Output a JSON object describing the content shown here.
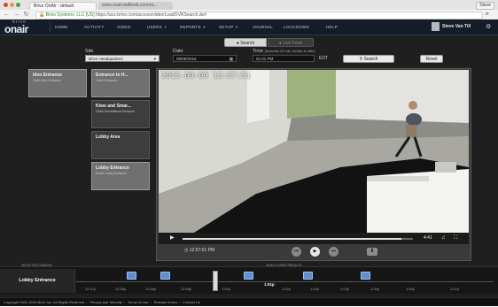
{
  "browser": {
    "tabs": [
      {
        "label": "Brivo OnAir - default"
      },
      {
        "label": "www.onairstaffweb.com/ac..."
      }
    ],
    "user_chip": "Steve",
    "url_secure": "Brivo Systems, LLC [US]",
    "url_path": "https://acs.brivo.com/access/video/LoadOVRSearch.do#"
  },
  "app": {
    "logo_top": "brivo",
    "logo_main": "onair",
    "nav": [
      "HOME",
      "ACTIVITY",
      "VIDEO",
      "USERS",
      "REPORTS",
      "SETUP",
      "JOURNAL",
      "LOCKDOWN",
      "HELP"
    ],
    "username": "Steve Van Till"
  },
  "mode": {
    "search_label": "Search",
    "live_label": "Live Feed"
  },
  "filters": {
    "site_label": "Site",
    "site_value": "Brivo Headquarters",
    "date_label": "Date",
    "date_value": "09/09/2015",
    "time_label": "Time",
    "time_hint": "(Includes 10 min. before & after)",
    "time_value": "01:01 PM",
    "tz": "EDT",
    "search_button": "Search",
    "reset_button": "Reset"
  },
  "cameras": [
    {
      "title": "Idvo Entrance",
      "sub": "OnAir Idvo Entrance"
    },
    {
      "title": "Entrance to H...",
      "sub": "OnAir Entrance..."
    },
    {
      "title": "Kiwo and Smar...",
      "sub": "OnAir Surveillance Entrance"
    },
    {
      "title": "Lobby Area",
      "sub": ""
    },
    {
      "title": "Lobby Entrance",
      "sub": "South Lobby Entrance"
    }
  ],
  "video": {
    "timestamp": "2015-09-09 12:57:51",
    "elapsed": "4:41",
    "clock": "12:57:01 PM",
    "progress": 0.95
  },
  "timeline": {
    "selected_camera_head": "SELECTED CAMERA",
    "results_head": "VIDEO EVENT RESULTS",
    "camera": "Lobby Entrance",
    "ticks": [
      "12:57p",
      "12:58p",
      "12:59p",
      "12:59p",
      "1:00p",
      "1:01p",
      "1:02p",
      "1:03p",
      "1:04p",
      "1:05p",
      "1:06p",
      "1:07p"
    ],
    "current": "1:01p"
  },
  "footer": {
    "copyright": "Copyright 2001-2015 Brivo Inc. All Rights Reserved",
    "links": [
      "Privacy and Security",
      "Terms of Use",
      "Release Notes",
      "Contact Us"
    ]
  }
}
